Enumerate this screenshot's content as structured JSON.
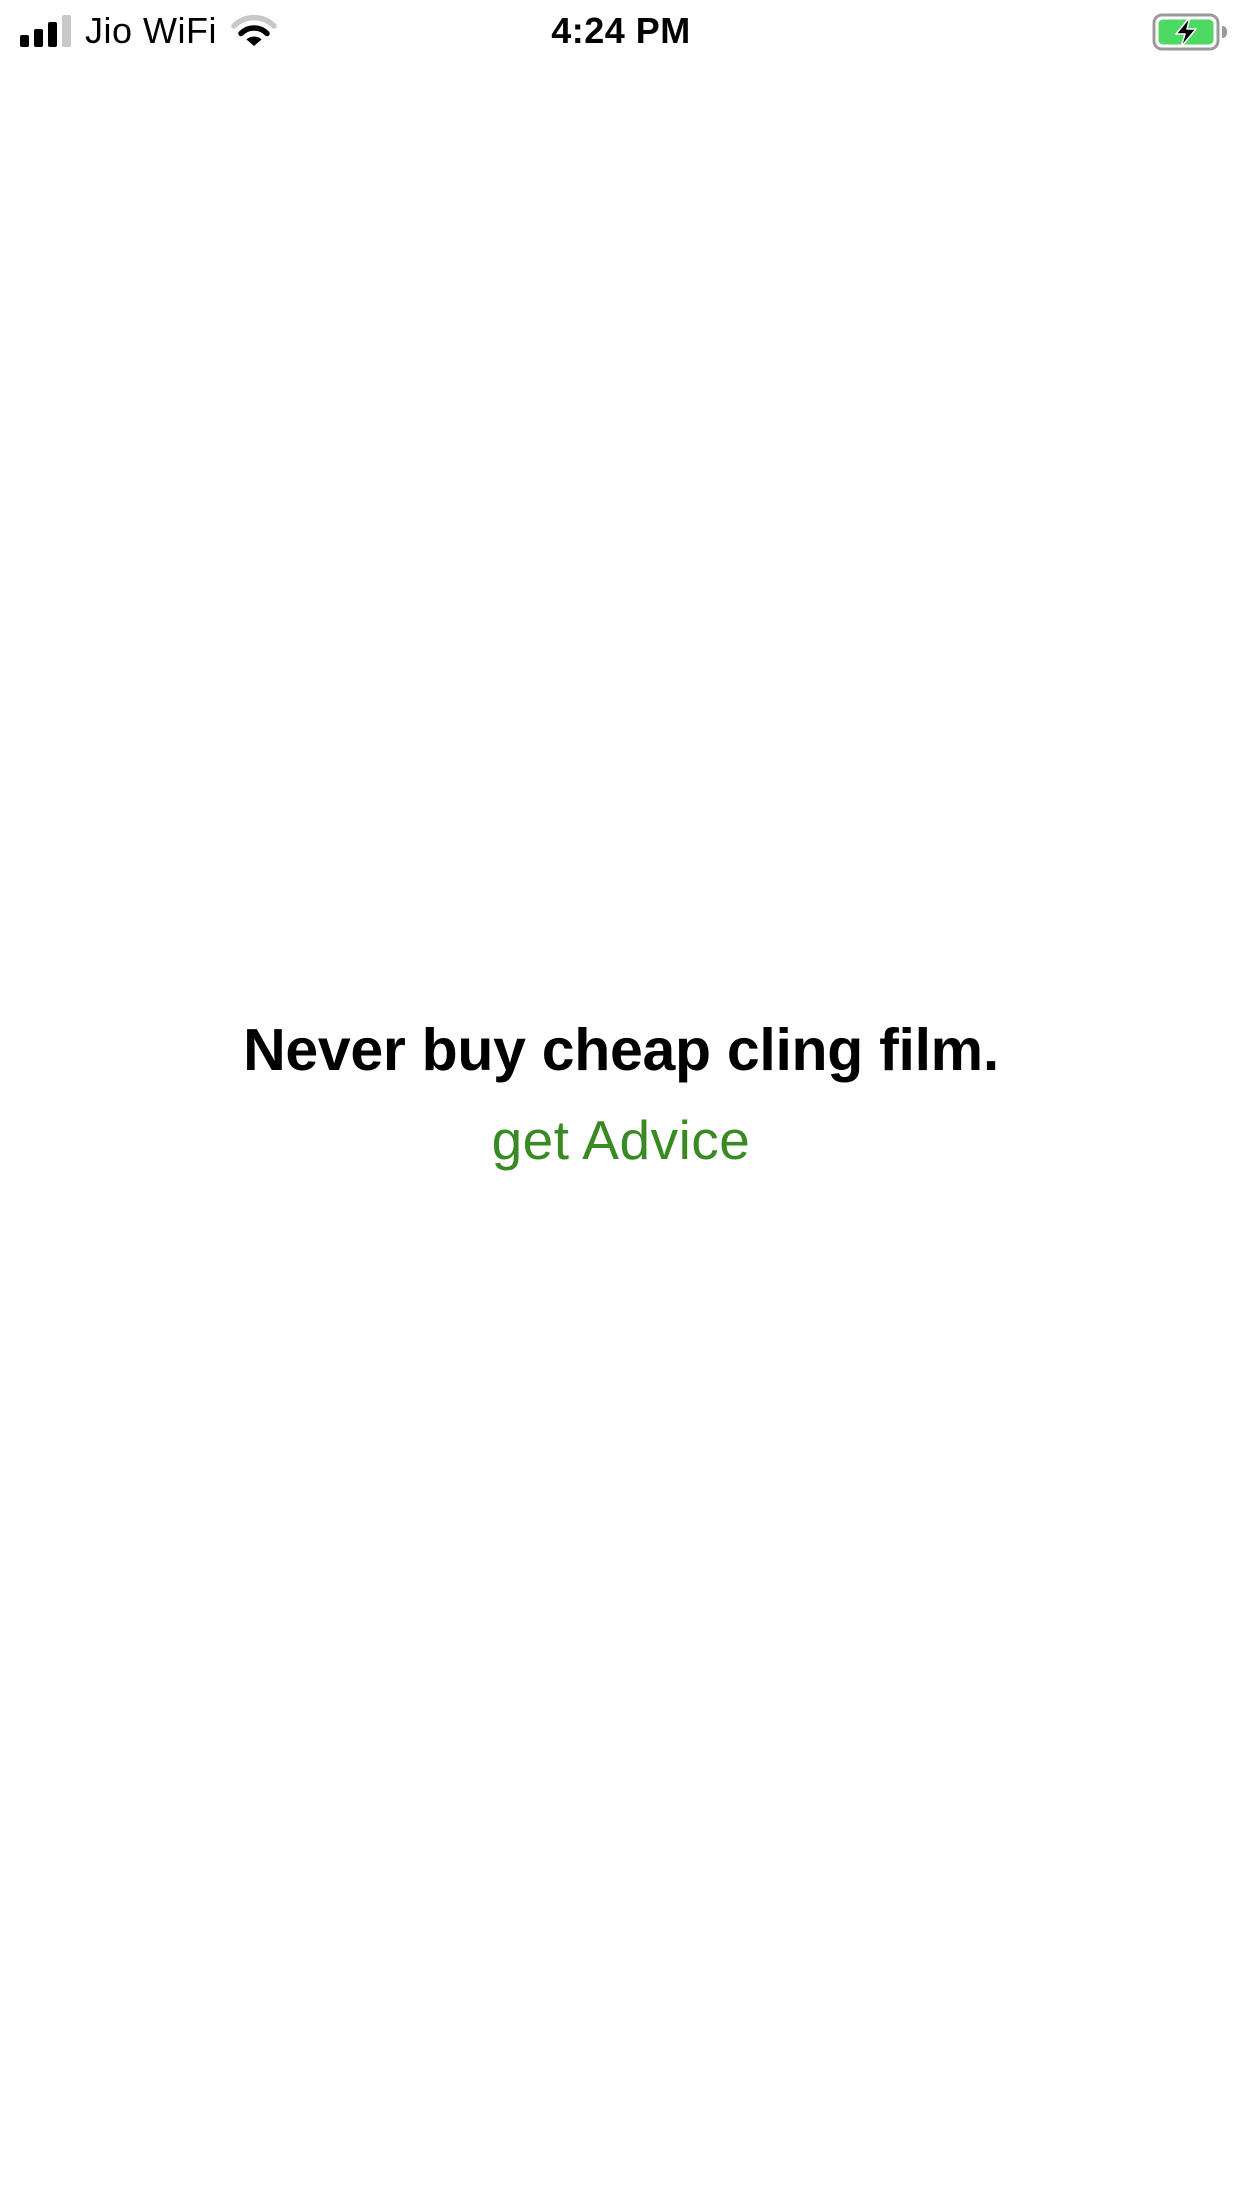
{
  "status_bar": {
    "carrier": "Jio WiFi",
    "time": "4:24 PM",
    "signal_bars_active": 3,
    "signal_bars_total": 4,
    "battery_state": "charging",
    "battery_color": "#4cd964",
    "icons": [
      "signal-icon",
      "wifi-icon",
      "battery-charging-icon"
    ]
  },
  "main": {
    "advice": "Never buy cheap cling film.",
    "button_label": "get Advice",
    "button_color": "#3a8a24"
  }
}
